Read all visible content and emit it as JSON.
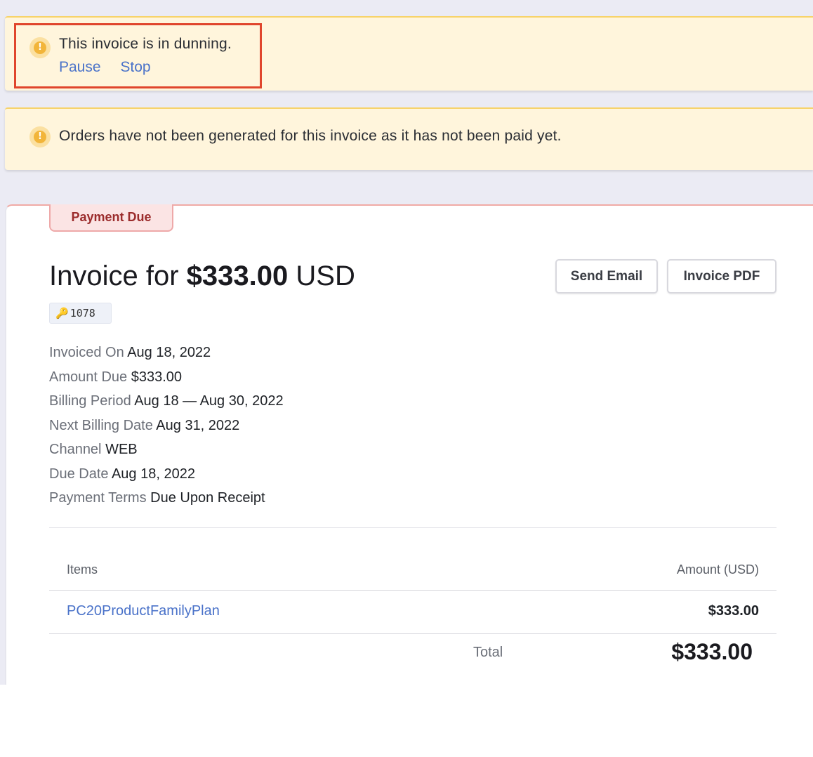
{
  "dunning_banner": {
    "message": "This invoice is in dunning.",
    "pause_label": "Pause",
    "stop_label": "Stop"
  },
  "orders_banner": {
    "message": "Orders have not been generated for this invoice as it has not been paid yet."
  },
  "invoice": {
    "status": "Payment Due",
    "title_prefix": "Invoice for",
    "amount": "$333.00",
    "currency": "USD",
    "id": "1078",
    "send_email_label": "Send Email",
    "pdf_label": "Invoice PDF",
    "details": [
      {
        "label": "Invoiced On",
        "value": "Aug 18, 2022"
      },
      {
        "label": "Amount Due",
        "value": "$333.00"
      },
      {
        "label": "Billing Period",
        "value": "Aug 18 — Aug 30, 2022"
      },
      {
        "label": "Next Billing Date",
        "value": "Aug 31, 2022"
      },
      {
        "label": "Channel",
        "value": "WEB"
      },
      {
        "label": "Due Date",
        "value": "Aug 18, 2022"
      },
      {
        "label": "Payment Terms",
        "value": "Due Upon Receipt"
      }
    ],
    "items_header": {
      "items": "Items",
      "amount": "Amount (USD)"
    },
    "items": [
      {
        "name": "PC20ProductFamilyPlan",
        "amount": "$333.00"
      }
    ],
    "total_label": "Total",
    "total_value": "$333.00"
  },
  "colors": {
    "accent_link": "#4a72c9",
    "warning_bg": "#fff5dc",
    "alert_icon": "#f2b53a",
    "status_tag_text": "#9b2c2c",
    "highlight": "#e0452c"
  },
  "icons": {
    "alert": "exclamation-circle-icon",
    "key": "key-icon"
  }
}
